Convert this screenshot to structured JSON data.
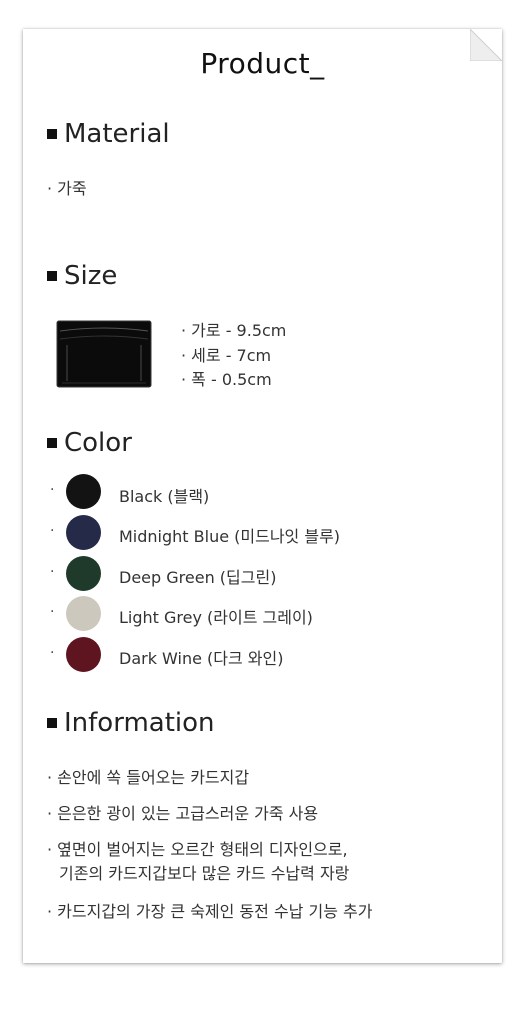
{
  "title": "Product_",
  "material": {
    "heading": "Material",
    "items": [
      "· 가죽"
    ]
  },
  "size": {
    "heading": "Size",
    "items": [
      "· 가로 - 9.5cm",
      "· 세로 - 7cm",
      "· 폭 - 0.5cm"
    ]
  },
  "color": {
    "heading": "Color",
    "bullet": "·",
    "items": [
      {
        "label": "Black (블랙)",
        "hex": "#131313"
      },
      {
        "label": "Midnight Blue (미드나잇 블루)",
        "hex": "#252a48"
      },
      {
        "label": "Deep Green (딥그린)",
        "hex": "#1f3a2b"
      },
      {
        "label": "Light Grey (라이트 그레이)",
        "hex": "#cdc8be"
      },
      {
        "label": "Dark Wine (다크 와인)",
        "hex": "#5e1520"
      }
    ]
  },
  "information": {
    "heading": "Information",
    "items": [
      "· 손안에 쏙 들어오는 카드지갑",
      "· 은은한 광이 있는 고급스러운 가죽 사용",
      "· 옆면이 벌어지는 오르간 형태의 디자인으로,",
      "기존의 카드지갑보다 많은 카드 수납력 자랑",
      "· 카드지갑의 가장 큰 숙제인 동전 수납 기능 추가"
    ]
  }
}
